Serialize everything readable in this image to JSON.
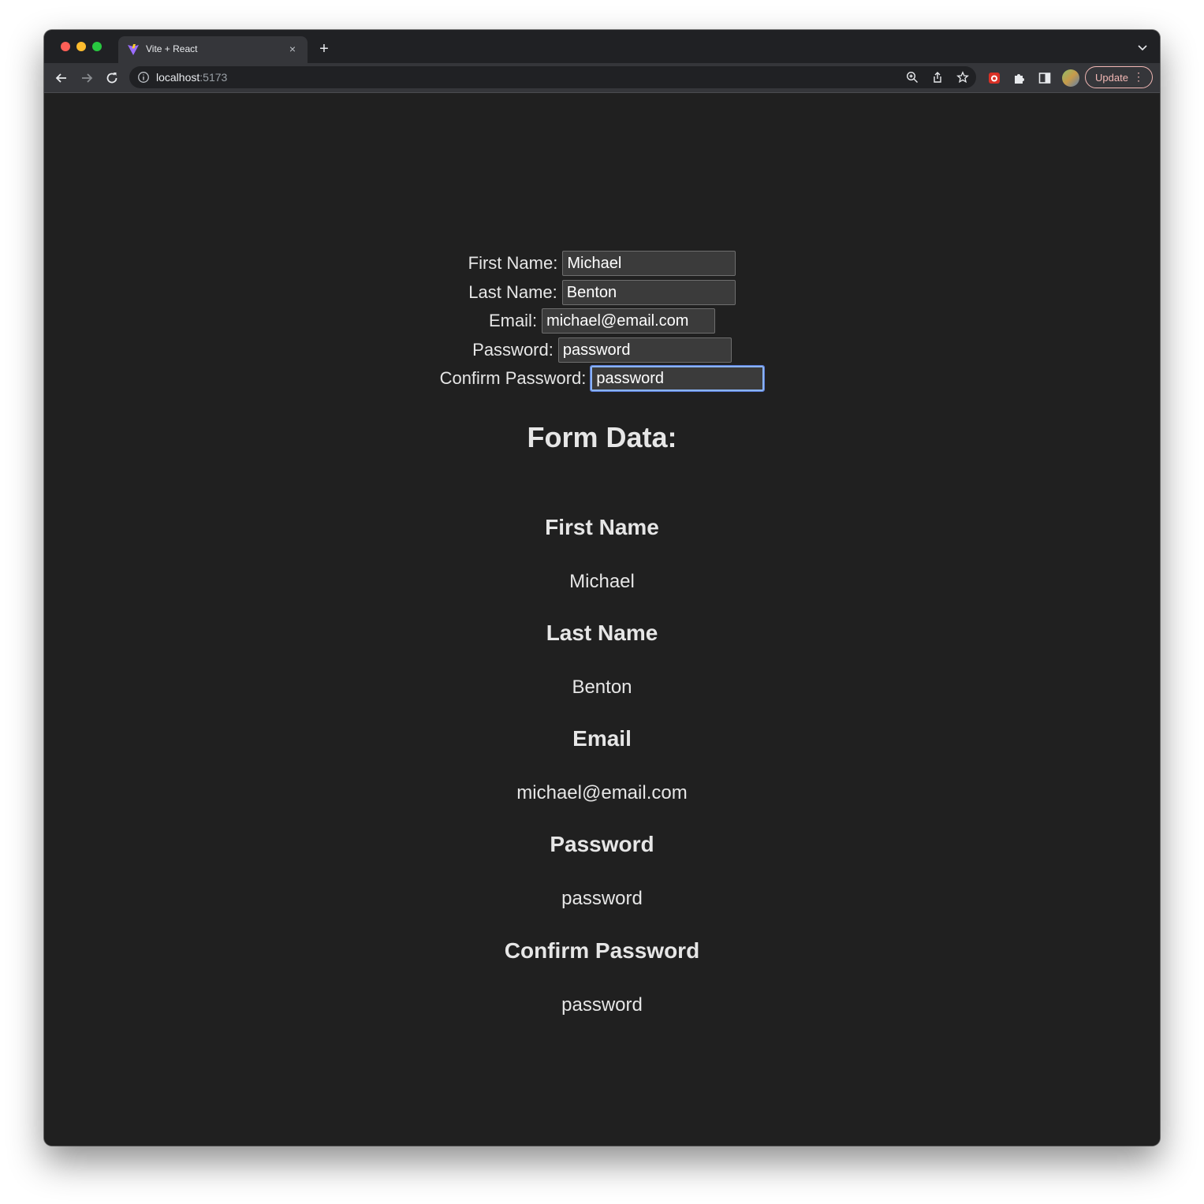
{
  "browser": {
    "tab_title": "Vite + React",
    "url_host": "localhost",
    "url_port": ":5173",
    "update_label": "Update",
    "close_glyph": "×",
    "newtab_glyph": "+",
    "menu_glyph": "⋮"
  },
  "form": {
    "fields": [
      {
        "label": "First Name:",
        "value": "Michael"
      },
      {
        "label": "Last Name:",
        "value": "Benton"
      },
      {
        "label": "Email:",
        "value": "michael@email.com"
      },
      {
        "label": "Password:",
        "value": "password"
      },
      {
        "label": "Confirm Password:",
        "value": "password"
      }
    ]
  },
  "form_data": {
    "heading": "Form Data:",
    "items": [
      {
        "title": "First Name",
        "value": "Michael"
      },
      {
        "title": "Last Name",
        "value": "Benton"
      },
      {
        "title": "Email",
        "value": "michael@email.com"
      },
      {
        "title": "Password",
        "value": "password"
      },
      {
        "title": "Confirm Password",
        "value": "password"
      }
    ]
  },
  "colors": {
    "page_bg": "#202020",
    "text": "#e6e6e6",
    "input_bg": "#3b3b3b",
    "focus": "#8ab4f8",
    "update_accent": "#f2b8b5"
  }
}
